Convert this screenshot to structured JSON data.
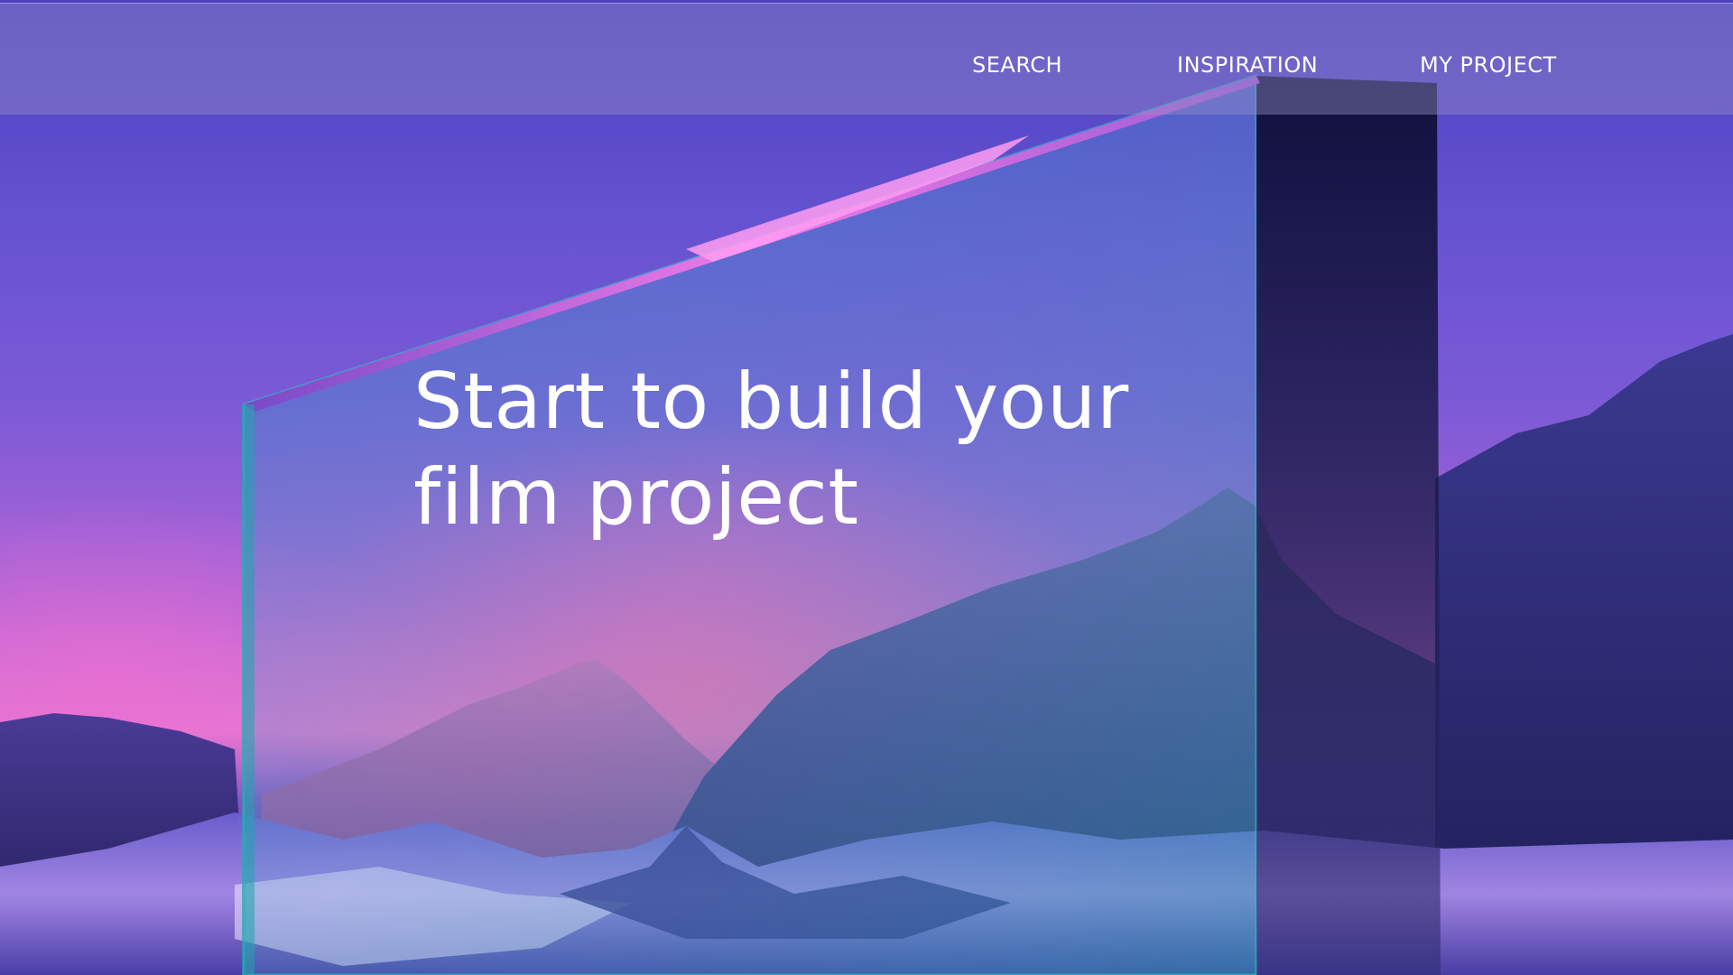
{
  "nav": {
    "items": [
      {
        "label": "SEARCH"
      },
      {
        "label": "INSPIRATION"
      },
      {
        "label": "MY PROJECT"
      }
    ]
  },
  "hero": {
    "title_line1": "Start to build your",
    "title_line2": "film project"
  },
  "background": {
    "description_icon": "mountain-landscape-with-glass-monolith",
    "colors": {
      "sky_top": "#4a3fbf",
      "sky_mid": "#7d5ad6",
      "glow_pink": "#ff69b4",
      "mountain_dark": "#2a2870",
      "glass_tint": "#2aa0b8"
    }
  }
}
